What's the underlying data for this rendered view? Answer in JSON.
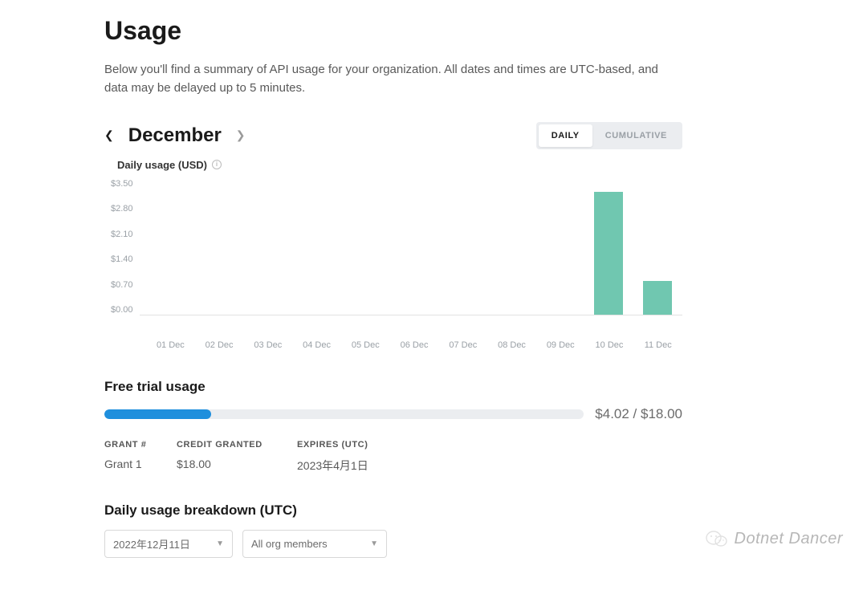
{
  "page_title": "Usage",
  "description": "Below you'll find a summary of API usage for your organization. All dates and times are UTC-based, and data may be delayed up to 5 minutes.",
  "month_nav": {
    "month": "December"
  },
  "toggle": {
    "daily": "DAILY",
    "cumulative": "CUMULATIVE",
    "active": "DAILY"
  },
  "chart_title": "Daily usage (USD)",
  "chart_data": {
    "type": "bar",
    "title": "Daily usage (USD)",
    "xlabel": "",
    "ylabel": "",
    "categories": [
      "01 Dec",
      "02 Dec",
      "03 Dec",
      "04 Dec",
      "05 Dec",
      "06 Dec",
      "07 Dec",
      "08 Dec",
      "09 Dec",
      "10 Dec",
      "11 Dec"
    ],
    "values": [
      0,
      0,
      0,
      0,
      0,
      0,
      0,
      0,
      0,
      3.15,
      0.87
    ],
    "y_ticks": [
      "$3.50",
      "$2.80",
      "$2.10",
      "$1.40",
      "$0.70",
      "$0.00"
    ],
    "ylim": [
      0,
      3.5
    ]
  },
  "free_trial": {
    "title": "Free trial usage",
    "used_label": "$4.02 / $18.00",
    "used": 4.02,
    "total": 18.0,
    "headers": {
      "grant": "GRANT #",
      "credit": "CREDIT GRANTED",
      "expires": "EXPIRES (UTC)"
    },
    "rows": [
      {
        "grant": "Grant 1",
        "credit": "$18.00",
        "expires": "2023年4月1日"
      }
    ]
  },
  "breakdown": {
    "title": "Daily usage breakdown (UTC)",
    "date_selected": "2022年12月11日",
    "members_selected": "All org members"
  },
  "watermark": "Dotnet Dancer"
}
